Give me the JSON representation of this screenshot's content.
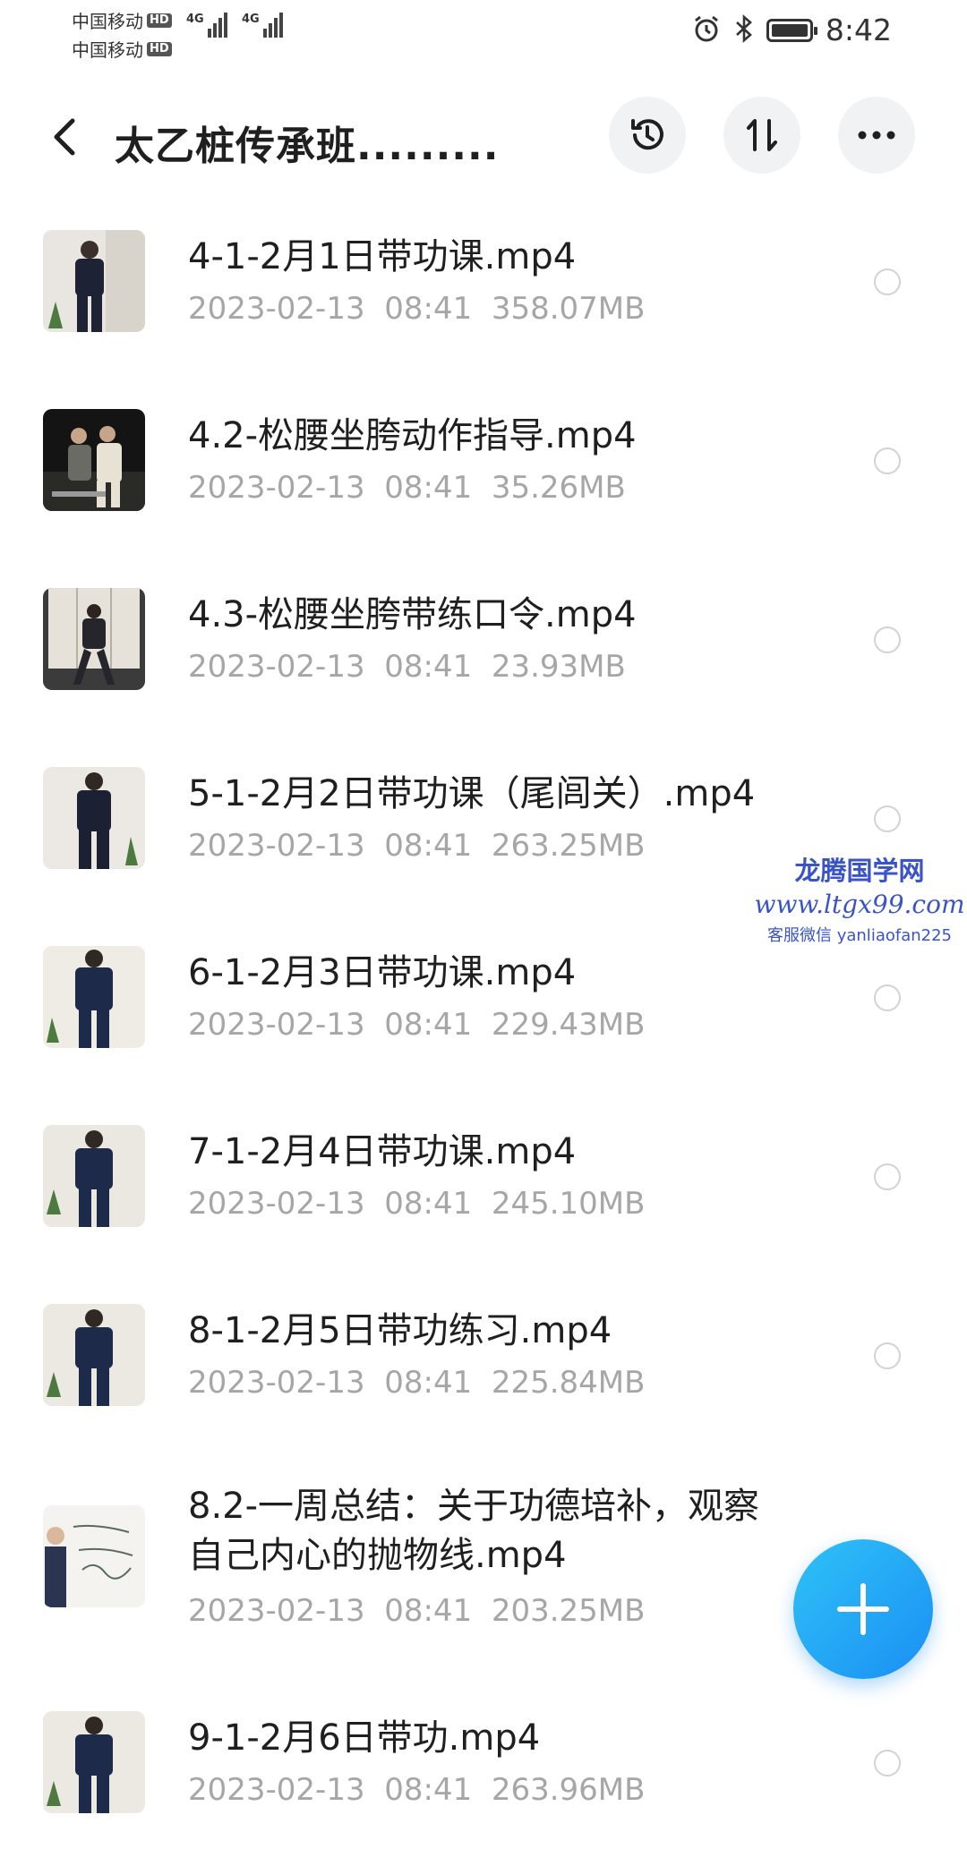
{
  "status_bar": {
    "carrier1": "中国移动",
    "carrier2": "中国移动",
    "hd_label": "HD",
    "network1": "4G",
    "network2": "4G",
    "time": "8:42",
    "icons": [
      "alarm-icon",
      "bluetooth-icon",
      "battery-icon"
    ]
  },
  "header": {
    "title": "太乙桩传承班.........",
    "icons": [
      "back-arrow-icon",
      "history-icon",
      "sort-icon",
      "more-icon"
    ]
  },
  "files": [
    {
      "name": "4-1-2月1日带功课.mp4",
      "date": "2023-02-13",
      "time": "08:41",
      "size": "358.07MB",
      "thumb": "person-standing"
    },
    {
      "name": "4.2-松腰坐胯动作指导.mp4",
      "date": "2023-02-13",
      "time": "08:41",
      "size": "35.26MB",
      "thumb": "two-people-dark"
    },
    {
      "name": "4.3-松腰坐胯带练口令.mp4",
      "date": "2023-02-13",
      "time": "08:41",
      "size": "23.93MB",
      "thumb": "person-stance"
    },
    {
      "name": "5-1-2月2日带功课（尾闾关）.mp4",
      "date": "2023-02-13",
      "time": "08:41",
      "size": "263.25MB",
      "thumb": "person-standing"
    },
    {
      "name": "6-1-2月3日带功课.mp4",
      "date": "2023-02-13",
      "time": "08:41",
      "size": "229.43MB",
      "thumb": "person-standing"
    },
    {
      "name": "7-1-2月4日带功课.mp4",
      "date": "2023-02-13",
      "time": "08:41",
      "size": "245.10MB",
      "thumb": "person-standing"
    },
    {
      "name": "8-1-2月5日带功练习.mp4",
      "date": "2023-02-13",
      "time": "08:41",
      "size": "225.84MB",
      "thumb": "person-standing"
    },
    {
      "name_line1": "8.2-一周总结：关于功德培补，观察",
      "name_line2": "自己内心的抛物线.mp4",
      "date": "2023-02-13",
      "time": "08:41",
      "size": "203.25MB",
      "thumb": "whiteboard"
    },
    {
      "name": "9-1-2月6日带功.mp4",
      "date": "2023-02-13",
      "time": "08:41",
      "size": "263.96MB",
      "thumb": "person-standing"
    }
  ],
  "watermark": {
    "line1": "龙腾国学网",
    "line2": "www.ltgx99.com",
    "line3": "客服微信 yanliaofan225"
  },
  "fab": {
    "icon": "plus-icon"
  },
  "colors": {
    "accent": "#1a8ff3",
    "meta_text": "#a6a6a6",
    "watermark": "#3a54c7"
  }
}
